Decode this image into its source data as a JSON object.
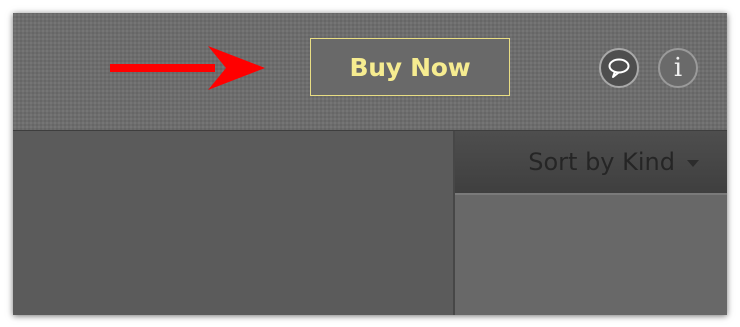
{
  "toolbar": {
    "buy_now_label": "Buy Now",
    "comment_icon": "speech-bubble-icon",
    "info_icon": "info-icon",
    "info_glyph": "i"
  },
  "annotation": {
    "arrow_icon": "red-arrow-icon",
    "arrow_color": "#ff0000"
  },
  "sort": {
    "label": "Sort by Kind",
    "caret_icon": "caret-down-icon"
  },
  "colors": {
    "accent_button_text": "#f6ec90",
    "accent_button_border": "#e9de84"
  }
}
